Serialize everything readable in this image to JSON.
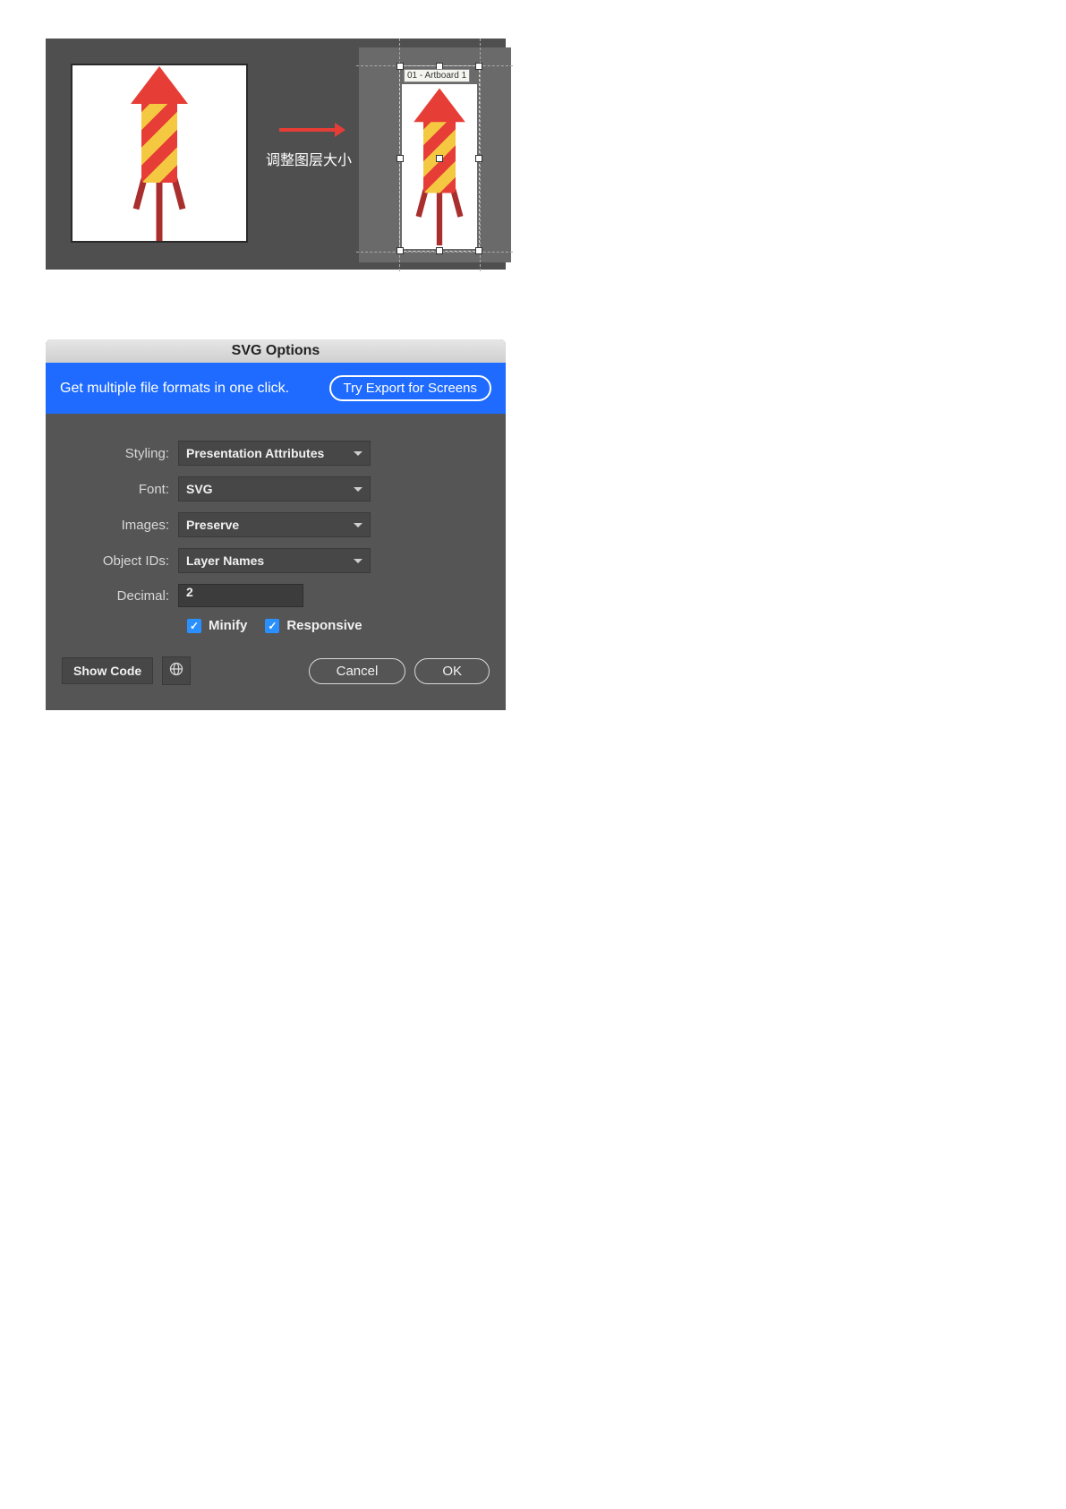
{
  "illustration": {
    "arrow_label": "调整图层大小",
    "artboard_label": "01 - Artboard 1"
  },
  "dialog": {
    "title": "SVG Options",
    "banner_text": "Get multiple file formats in one click.",
    "banner_button": "Try Export for Screens",
    "fields": {
      "styling": {
        "label": "Styling:",
        "value": "Presentation Attributes"
      },
      "font": {
        "label": "Font:",
        "value": "SVG"
      },
      "images": {
        "label": "Images:",
        "value": "Preserve"
      },
      "object_ids": {
        "label": "Object IDs:",
        "value": "Layer Names"
      },
      "decimal": {
        "label": "Decimal:",
        "value": "2"
      }
    },
    "minify": {
      "label": "Minify",
      "checked": true
    },
    "responsive": {
      "label": "Responsive",
      "checked": true
    },
    "show_code": "Show Code",
    "cancel": "Cancel",
    "ok": "OK"
  }
}
